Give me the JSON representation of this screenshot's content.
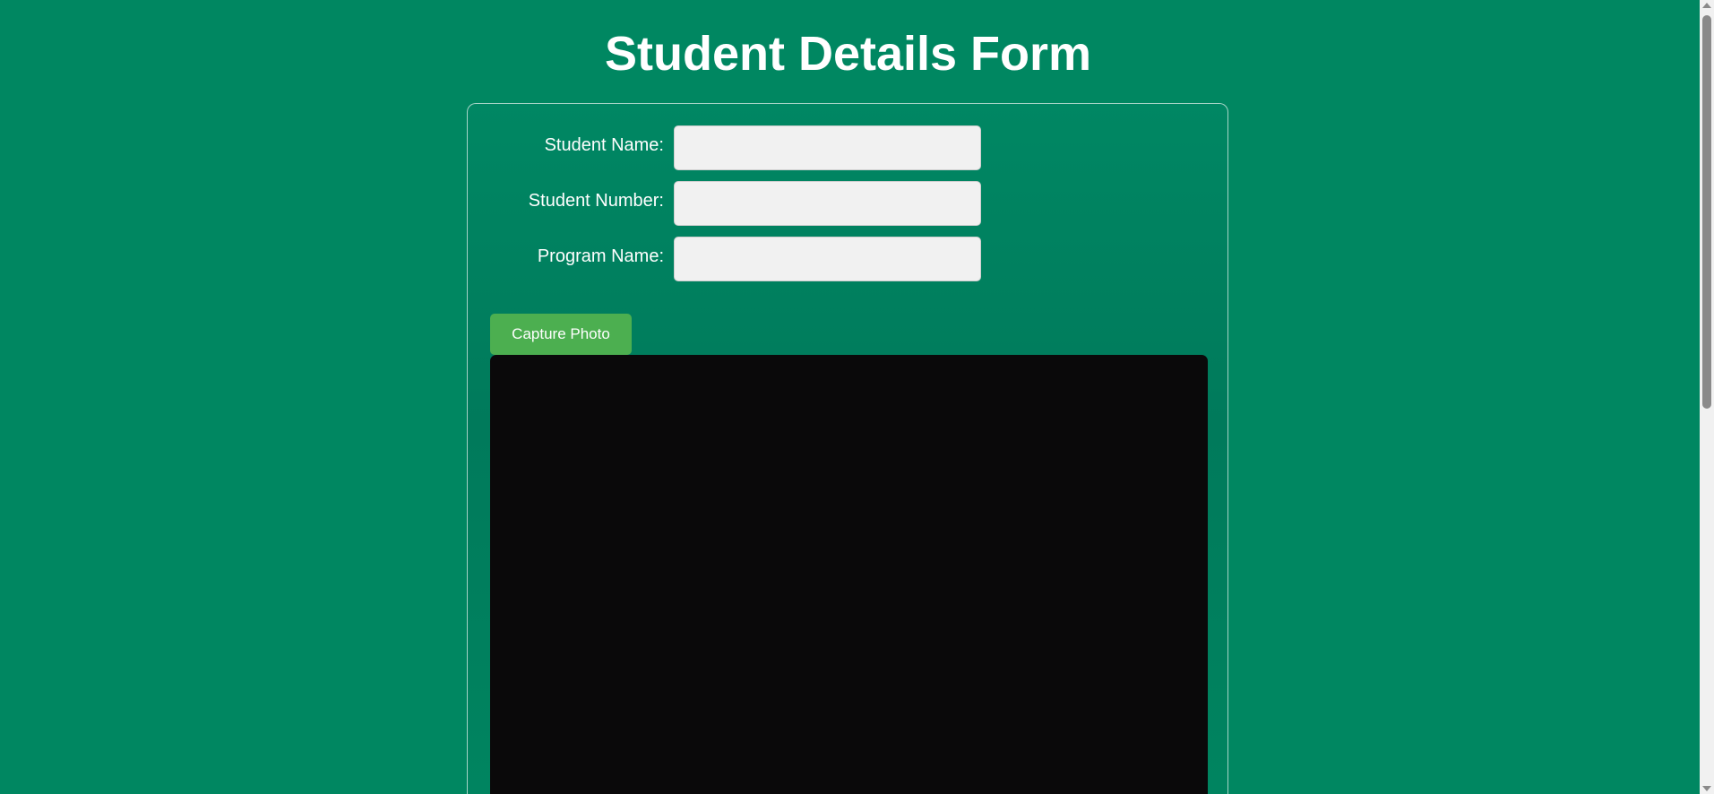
{
  "page": {
    "title": "Student Details Form"
  },
  "form": {
    "fields": [
      {
        "label": "Student Name:",
        "value": "",
        "placeholder": ""
      },
      {
        "label": "Student Number:",
        "value": "",
        "placeholder": ""
      },
      {
        "label": "Program Name:",
        "value": "",
        "placeholder": ""
      }
    ],
    "capture_button_label": "Capture Photo"
  },
  "colors": {
    "background": "#008761",
    "button": "#4caf50",
    "video_area": "#0a090a",
    "input_background": "#f1f1f1"
  }
}
